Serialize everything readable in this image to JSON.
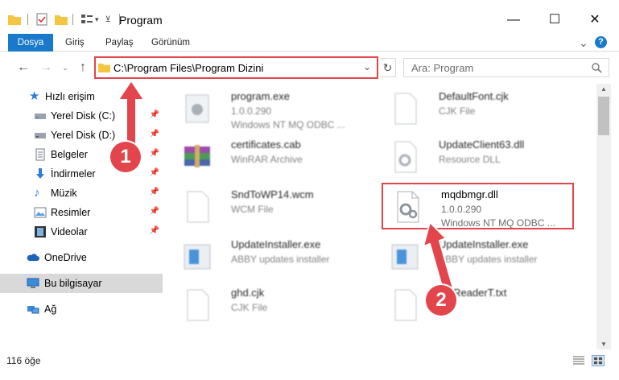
{
  "window": {
    "title": "Program",
    "minimize": "—",
    "maximize": "☐",
    "close": "✕"
  },
  "ribbon": {
    "tabs": [
      "Dosya",
      "Giriş",
      "Paylaş",
      "Görünüm"
    ],
    "expand": "⌄",
    "help": "?"
  },
  "address": {
    "path": "C:\\Program Files\\Program Dizini",
    "search_placeholder": "Ara: Program"
  },
  "sidebar": {
    "items": [
      {
        "label": "Hızlı erişim",
        "icon": "star-icon"
      },
      {
        "label": "Yerel Disk (C:)",
        "icon": "drive-icon"
      },
      {
        "label": "Yerel Disk (D:)",
        "icon": "drive-icon"
      },
      {
        "label": "Belgeler",
        "icon": "documents-icon"
      },
      {
        "label": "İndirmeler",
        "icon": "download-icon"
      },
      {
        "label": "Müzik",
        "icon": "music-icon"
      },
      {
        "label": "Resimler",
        "icon": "pictures-icon"
      },
      {
        "label": "Videolar",
        "icon": "video-icon"
      },
      {
        "label": "OneDrive",
        "icon": "cloud-icon"
      },
      {
        "label": "Bu bilgisayar",
        "icon": "computer-icon"
      },
      {
        "label": "Ağ",
        "icon": "network-icon"
      }
    ]
  },
  "files": [
    {
      "name": "program.exe",
      "line2": "1.0.0.290",
      "line3": "Windows NT MQ ODBC ..."
    },
    {
      "name": "DefaultFont.cjk",
      "line2": "CJK File",
      "line3": ""
    },
    {
      "name": "certificates.cab",
      "line2": "WinRAR Archive",
      "line3": ""
    },
    {
      "name": "UpdateClient63.dll",
      "line2": "Resource DLL",
      "line3": ""
    },
    {
      "name": "SndToWP14.wcm",
      "line2": "WCM File",
      "line3": ""
    },
    {
      "name": "mqdbmgr.dll",
      "line2": "1.0.0.290",
      "line3": "Windows NT MQ ODBC ..."
    },
    {
      "name": "UpdateInstaller.exe",
      "line2": "ABBY updates installer",
      "line3": ""
    },
    {
      "name": "UpdateInstaller.exe",
      "line2": "ABBY updates installer",
      "line3": ""
    },
    {
      "name": "ghd.cjk",
      "line2": "CJK File",
      "line3": ""
    },
    {
      "name": "h...ReaderT.txt",
      "line2": "",
      "line3": ""
    }
  ],
  "status": {
    "count": "116 öğe"
  },
  "markers": {
    "one": "1",
    "two": "2"
  },
  "colors": {
    "accent": "#1979ca",
    "highlight": "#e3454c"
  }
}
